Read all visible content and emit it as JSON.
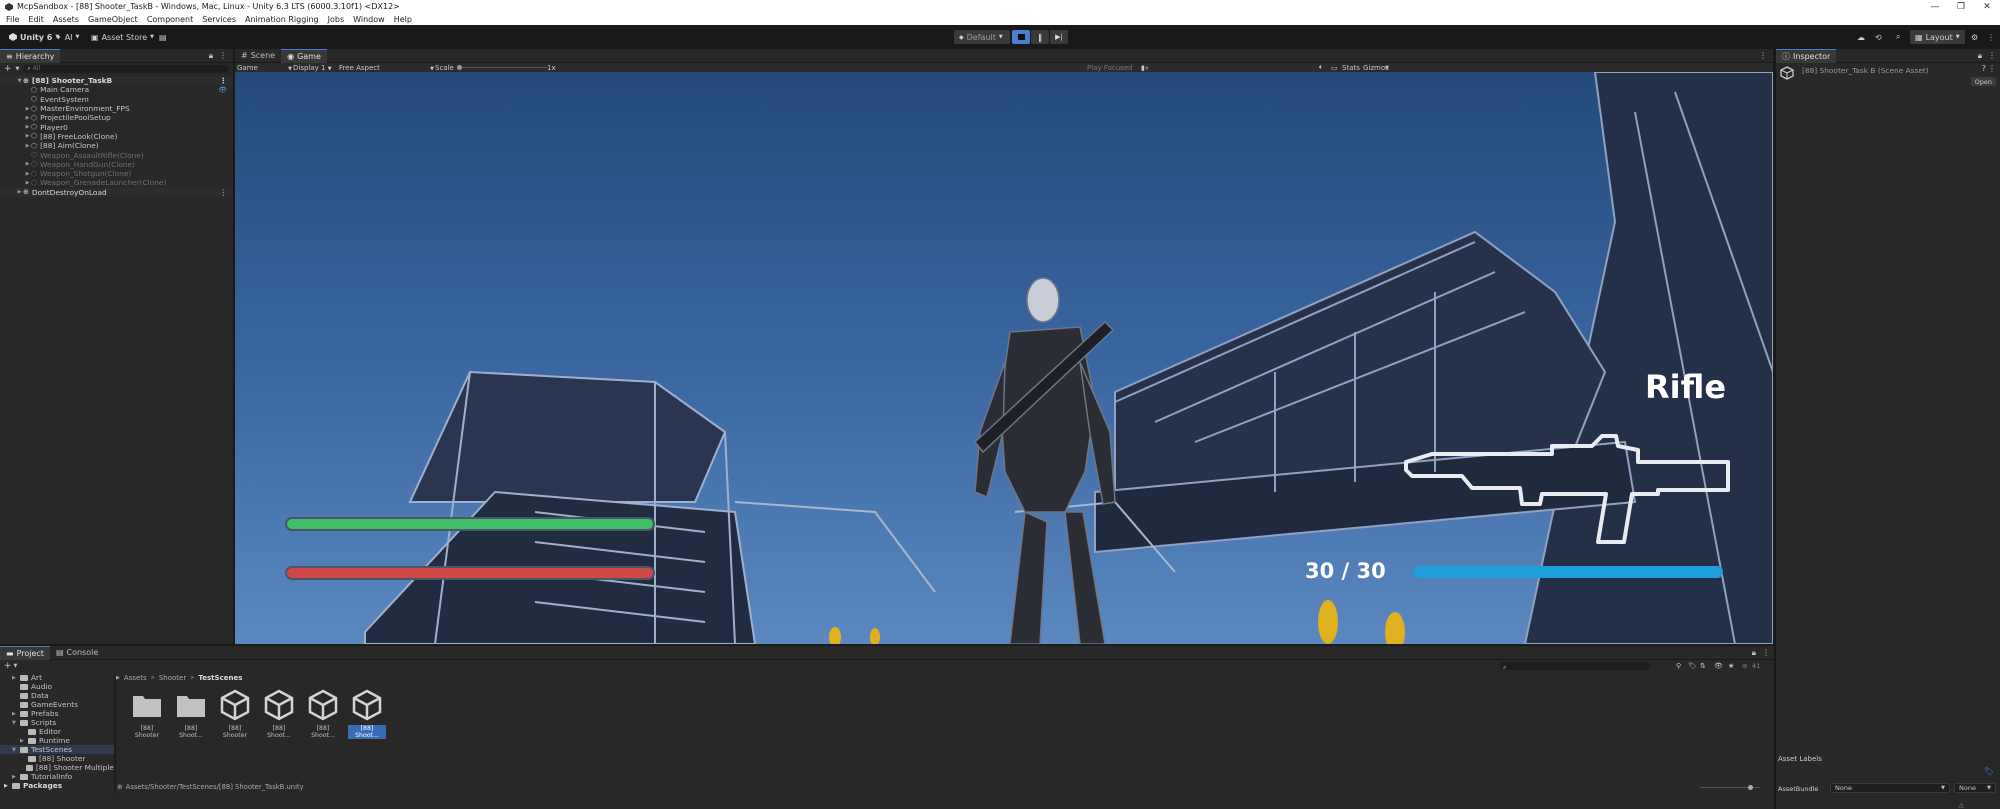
{
  "window": {
    "title": "McpSandbox - [88] Shooter_TaskB - Windows, Mac, Linux - Unity 6.3 LTS (6000.3.10f1) <DX12>",
    "controls": [
      "—",
      "❐",
      "✕"
    ]
  },
  "menu": [
    "File",
    "Edit",
    "Assets",
    "GameObject",
    "Component",
    "Services",
    "Animation Rigging",
    "Jobs",
    "Window",
    "Help"
  ],
  "toolbar": {
    "account": "Unity 6",
    "ai": "AI",
    "asset_store": "Asset Store",
    "play_mode": "Default",
    "layout": "Layout"
  },
  "hierarchy": {
    "tab": "Hierarchy",
    "search_placeholder": "All",
    "scene": "[88] Shooter_TaskB",
    "items": [
      {
        "label": "Main Camera",
        "indent": 2,
        "arrow": "",
        "dim": false
      },
      {
        "label": "EventSystem",
        "indent": 2,
        "arrow": "",
        "dim": false
      },
      {
        "label": "MasterEnvironment_FPS",
        "indent": 2,
        "arrow": "▶",
        "dim": false
      },
      {
        "label": "ProjectilePoolSetup",
        "indent": 2,
        "arrow": "▶",
        "dim": false
      },
      {
        "label": "Player0",
        "indent": 2,
        "arrow": "▶",
        "dim": false
      },
      {
        "label": "[88] FreeLook(Clone)",
        "indent": 2,
        "arrow": "▶",
        "dim": false
      },
      {
        "label": "[88] Aim(Clone)",
        "indent": 2,
        "arrow": "▶",
        "dim": false
      },
      {
        "label": "Weapon_AssaultRifle(Clone)",
        "indent": 2,
        "arrow": "",
        "dim": true
      },
      {
        "label": "Weapon_HandGun(Clone)",
        "indent": 2,
        "arrow": "▶",
        "dim": true
      },
      {
        "label": "Weapon_Shotgun(Clone)",
        "indent": 2,
        "arrow": "▶",
        "dim": true
      },
      {
        "label": "Weapon_GrenadeLauncher(Clone)",
        "indent": 2,
        "arrow": "▶",
        "dim": true
      }
    ],
    "dontdestroy": "DontDestroyOnLoad"
  },
  "game_panel": {
    "tabs": [
      "Scene",
      "Game"
    ],
    "display_mode": "Game",
    "display": "Display 1",
    "aspect": "Free Aspect",
    "scale_label": "Scale",
    "scale_value": "1x",
    "play_focused": "Play Focused",
    "stats": "Stats",
    "gizmos": "Gizmos"
  },
  "hud": {
    "weapon_name": "Rifle",
    "ammo": "30 / 30",
    "health_level": 1.0,
    "stamina_level": 1.0,
    "ammo_level": 1.0,
    "colors": {
      "health": "#3fbf6a",
      "stamina": "#d04848",
      "ammo": "#1e9fd9"
    }
  },
  "inspector": {
    "tab": "Inspector",
    "title": "[88] Shooter_Task B (Scene Asset)",
    "open_button": "Open",
    "asset_labels": "Asset Labels",
    "assetbundle_label": "AssetBundle",
    "assetbundle_value": "None",
    "variant_value": "None"
  },
  "project": {
    "tabs": [
      "Project",
      "Console"
    ],
    "tree": [
      {
        "label": "Art",
        "indent": 1,
        "arrow": "▶"
      },
      {
        "label": "Audio",
        "indent": 1,
        "arrow": ""
      },
      {
        "label": "Data",
        "indent": 1,
        "arrow": ""
      },
      {
        "label": "GameEvents",
        "indent": 1,
        "arrow": ""
      },
      {
        "label": "Prefabs",
        "indent": 1,
        "arrow": "▶"
      },
      {
        "label": "Scripts",
        "indent": 1,
        "arrow": "▼"
      },
      {
        "label": "Editor",
        "indent": 2,
        "arrow": ""
      },
      {
        "label": "Runtime",
        "indent": 2,
        "arrow": "▶"
      },
      {
        "label": "TestScenes",
        "indent": 1,
        "arrow": "▼"
      },
      {
        "label": "[88] Shooter",
        "indent": 2,
        "arrow": ""
      },
      {
        "label": "[88] Shooter Multiple",
        "indent": 2,
        "arrow": ""
      },
      {
        "label": "TutorialInfo",
        "indent": 1,
        "arrow": "▶"
      }
    ],
    "packages": "Packages",
    "breadcrumb": [
      "Assets",
      "Shooter",
      "TestScenes"
    ],
    "assets": [
      {
        "label": "[88] Shooter",
        "kind": "folder"
      },
      {
        "label": "[88] Shoot...",
        "kind": "folder"
      },
      {
        "label": "[88] Shooter",
        "kind": "scene"
      },
      {
        "label": "[88] Shoot...",
        "kind": "scene"
      },
      {
        "label": "[88] Shoot...",
        "kind": "scene"
      },
      {
        "label": "[88] Shoot...",
        "kind": "scene"
      }
    ],
    "count": "41",
    "status_path": "Assets/Shooter/TestScenes/[88] Shooter_TaskB.unity"
  }
}
